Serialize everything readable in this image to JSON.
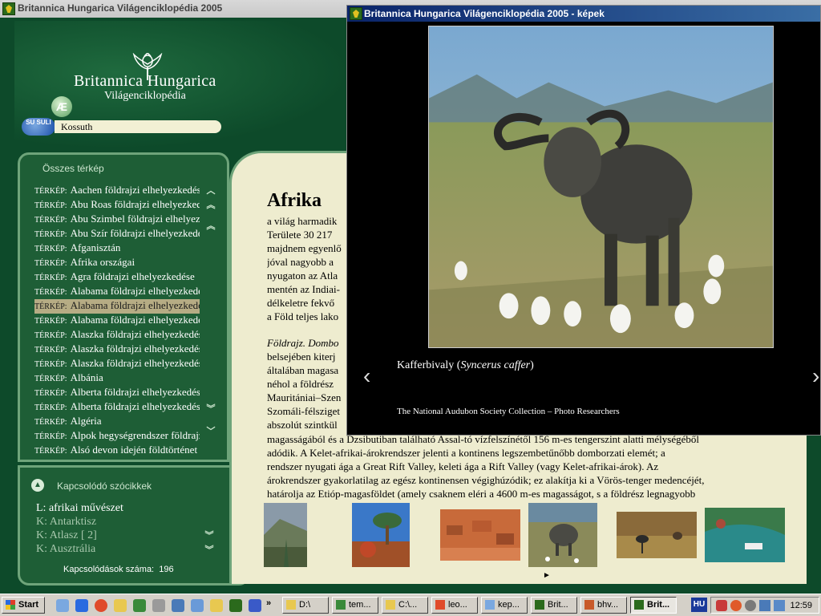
{
  "main_window": {
    "title": "Britannica Hungarica Világenciklopédia 2005",
    "brand_name": "Britannica  Hungarica",
    "brand_sub": "Világenciklopédia",
    "ae_symbol": "Æ",
    "badge": "SU SULI",
    "search_value": "Kossuth"
  },
  "map_panel": {
    "title": "Összes térkép",
    "prefix": "TÉRKÉP:",
    "items": [
      "Aachen földrajzi elhelyezkedése",
      "Abu Roas földrajzi elhelyezkedése",
      "Abu Szimbel földrajzi elhelyezkedése",
      "Abu Szír földrajzi elhelyezkedése",
      "Afganisztán",
      "Afrika országai",
      "Agra földrajzi elhelyezkedése",
      "Alabama földrajzi elhelyezkedése",
      "Alabama földrajzi elhelyezkedése",
      "Alabama földrajzi elhelyezkedése",
      "Alaszka földrajzi elhelyezkedése",
      "Alaszka földrajzi elhelyezkedése",
      "Alaszka földrajzi elhelyezkedése",
      "Albánia",
      "Alberta földrajzi elhelyezkedése",
      "Alberta földrajzi elhelyezkedése",
      "Algéria",
      "Alpok hegységrendszer földrajzi",
      "Alsó devon idején földtörténet"
    ],
    "selected_index": 8
  },
  "related_panel": {
    "title": "Kapcsolódó szócikkek",
    "items": [
      "L: afrikai művészet",
      "K: Antarktisz",
      "K: Atlasz [ 2]",
      "K: Ausztrália"
    ],
    "count_label": "Kapcsolódások száma:",
    "count": "196"
  },
  "article": {
    "title": "Afrika",
    "intro_lines": [
      "a világ harmadik",
      "Területe 30 217",
      "majdnem egyenlő",
      "jóval nagyobb a",
      "nyugaton az Atla",
      "mentén az Indiai-",
      "délkeletre fekvő",
      "a Föld teljes lako"
    ],
    "section_lines": [
      "Földrajz. Dombo",
      "belsejében kiterj",
      "általában magasa",
      "néhol a földrész",
      "Mauritániai–Szen",
      "Szomáli-félsziget",
      "abszolút szintkül"
    ],
    "lower_lines": [
      "magasságából és a Dzsibutiban található Assal-tó vízfelszínétől 156 m-es tengerszint alatti mélységéből",
      "adódik. A Kelet-afrikai-árokrendszer jelenti a kontinens legszembetűnőbb domborzati elemét; a",
      "rendszer nyugati ága a Great Rift Valley, keleti ága a Rift Valley (vagy Kelet-afrikai-árok). Az",
      "árokrendszer gyakorlatilag az egész kontinensen végighúzódik; ez alakítja ki a Vörös-tenger medencéjét,",
      "határolja az Etióp-magasföldet (amely csaknem eléri a 4600 m-es magasságot, s a földrész legnagyobb"
    ],
    "more_arrow": "►"
  },
  "image_window": {
    "title": "Britannica Hungarica Világenciklopédia 2005 - képek",
    "caption_prefix": "Kafferbivaly (",
    "caption_italic": "Syncerus caffer",
    "caption_suffix": ")",
    "credit": "The National Audubon Society Collection – Photo Researchers"
  },
  "taskbar": {
    "start_label": "Start",
    "tasks": [
      "D:\\",
      "tem...",
      "C:\\...",
      "leo...",
      "kep...",
      "Brit...",
      "bhv...",
      "Brit..."
    ],
    "active_task_index": 7,
    "language": "HU",
    "clock": "12:59"
  },
  "colors": {
    "panel_green": "#1e5e36",
    "page_bg": "#eeeccf",
    "accent_border": "#6ea47a"
  }
}
